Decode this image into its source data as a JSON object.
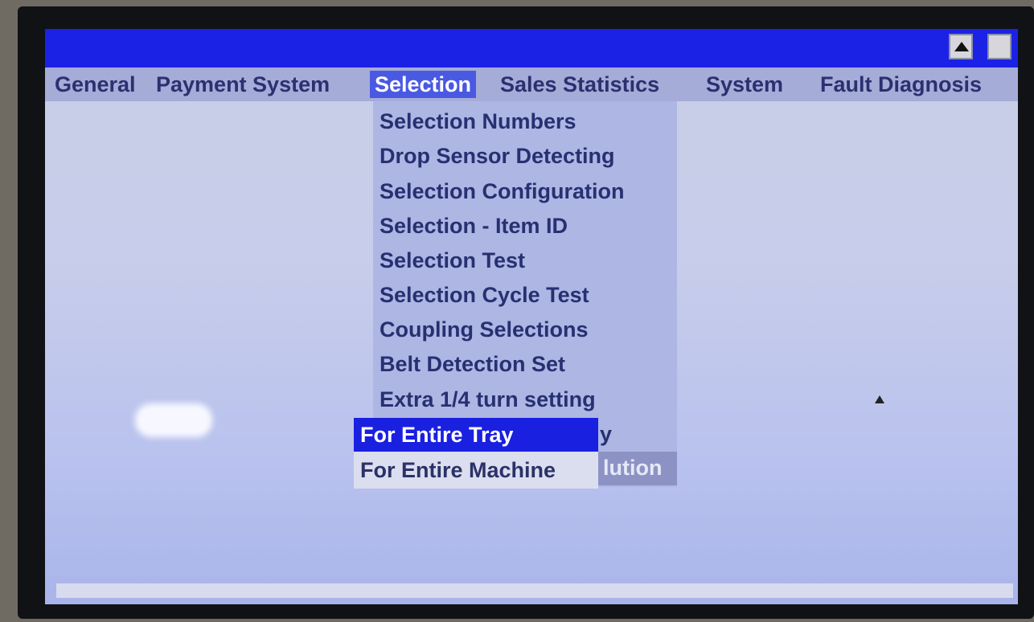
{
  "titlebar": {
    "scroll_up_icon": "up-triangle-icon"
  },
  "menubar": {
    "items": [
      {
        "label": "General"
      },
      {
        "label": "Payment System"
      },
      {
        "label": "Selection"
      },
      {
        "label": "Sales Statistics"
      },
      {
        "label": "System"
      },
      {
        "label": "Fault Diagnosis"
      }
    ],
    "active": "Selection"
  },
  "dropdown": {
    "items": [
      {
        "label": "Selection Numbers"
      },
      {
        "label": "Drop Sensor Detecting"
      },
      {
        "label": "Selection Configuration"
      },
      {
        "label": "Selection - Item ID"
      },
      {
        "label": "Selection Test"
      },
      {
        "label": "Selection Cycle Test"
      },
      {
        "label": "Coupling Selections"
      },
      {
        "label": "Belt Detection Set"
      },
      {
        "label": "Extra 1/4 turn setting"
      }
    ],
    "partial_items": [
      {
        "visible_text": "y"
      },
      {
        "visible_text": "lution"
      }
    ]
  },
  "submenu": {
    "items": [
      {
        "label": "For Entire Tray",
        "selected": true
      },
      {
        "label": "For Entire Machine",
        "selected": false
      }
    ]
  },
  "colors": {
    "titlebar": "#1b22e6",
    "menu_active": "#4a59e2",
    "submenu_selected": "#1a20e0",
    "menu_text": "#2b3070"
  }
}
